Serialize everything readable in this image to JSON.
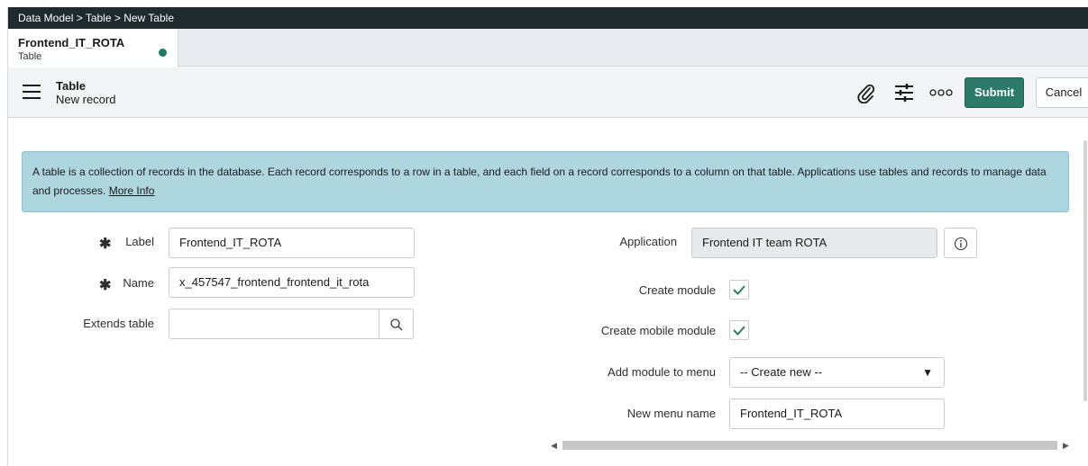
{
  "breadcrumb": "Data Model > Table > New Table",
  "tab": {
    "title": "Frontend_IT_ROTA",
    "subtitle": "Table"
  },
  "header": {
    "title": "Table",
    "subtitle": "New record",
    "submit_label": "Submit",
    "cancel_label": "Cancel",
    "icons": [
      "paperclip-icon",
      "sliders-icon",
      "more-options-icon",
      "hamburger-icon"
    ]
  },
  "info": {
    "text": "A table is a collection of records in the database. Each record corresponds to a row in a table, and each field on a record corresponds to a column on that table. Applications use tables and records to manage data and processes. ",
    "link": "More Info"
  },
  "form": {
    "label": {
      "label": "Label",
      "value": "Frontend_IT_ROTA"
    },
    "name": {
      "label": "Name",
      "value": "x_457547_frontend_frontend_it_rota"
    },
    "extends": {
      "label": "Extends table",
      "value": ""
    },
    "application": {
      "label": "Application",
      "value": "Frontend IT team ROTA"
    },
    "create_module": {
      "label": "Create module",
      "checked": true
    },
    "create_mobile_module": {
      "label": "Create mobile module",
      "checked": true
    },
    "add_module_to_menu": {
      "label": "Add module to menu",
      "value": "-- Create new --"
    },
    "new_menu_name": {
      "label": "New menu name",
      "value": "Frontend_IT_ROTA"
    }
  },
  "colors": {
    "breadcrumb_bg": "#1f2a2e",
    "submit_bg": "#2b7b68",
    "info_bg": "#aed6df",
    "tab_dot": "#1f7a66",
    "check": "#2b7b68"
  }
}
